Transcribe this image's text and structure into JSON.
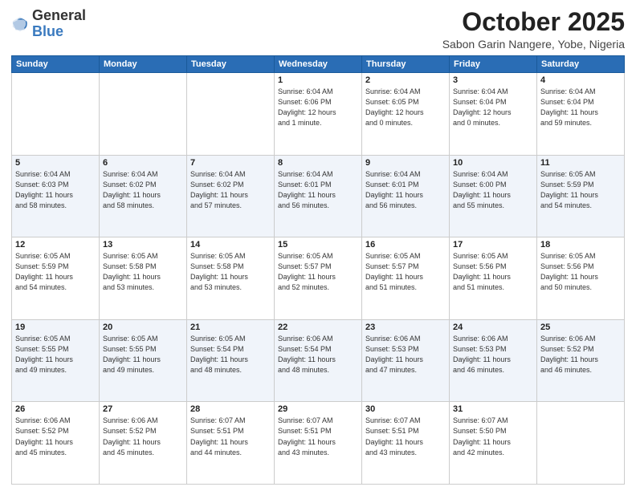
{
  "header": {
    "logo_general": "General",
    "logo_blue": "Blue",
    "month": "October 2025",
    "location": "Sabon Garin Nangere, Yobe, Nigeria"
  },
  "weekdays": [
    "Sunday",
    "Monday",
    "Tuesday",
    "Wednesday",
    "Thursday",
    "Friday",
    "Saturday"
  ],
  "weeks": [
    [
      {
        "day": null,
        "info": null
      },
      {
        "day": null,
        "info": null
      },
      {
        "day": null,
        "info": null
      },
      {
        "day": "1",
        "info": "Sunrise: 6:04 AM\nSunset: 6:06 PM\nDaylight: 12 hours\nand 1 minute."
      },
      {
        "day": "2",
        "info": "Sunrise: 6:04 AM\nSunset: 6:05 PM\nDaylight: 12 hours\nand 0 minutes."
      },
      {
        "day": "3",
        "info": "Sunrise: 6:04 AM\nSunset: 6:04 PM\nDaylight: 12 hours\nand 0 minutes."
      },
      {
        "day": "4",
        "info": "Sunrise: 6:04 AM\nSunset: 6:04 PM\nDaylight: 11 hours\nand 59 minutes."
      }
    ],
    [
      {
        "day": "5",
        "info": "Sunrise: 6:04 AM\nSunset: 6:03 PM\nDaylight: 11 hours\nand 58 minutes."
      },
      {
        "day": "6",
        "info": "Sunrise: 6:04 AM\nSunset: 6:02 PM\nDaylight: 11 hours\nand 58 minutes."
      },
      {
        "day": "7",
        "info": "Sunrise: 6:04 AM\nSunset: 6:02 PM\nDaylight: 11 hours\nand 57 minutes."
      },
      {
        "day": "8",
        "info": "Sunrise: 6:04 AM\nSunset: 6:01 PM\nDaylight: 11 hours\nand 56 minutes."
      },
      {
        "day": "9",
        "info": "Sunrise: 6:04 AM\nSunset: 6:01 PM\nDaylight: 11 hours\nand 56 minutes."
      },
      {
        "day": "10",
        "info": "Sunrise: 6:04 AM\nSunset: 6:00 PM\nDaylight: 11 hours\nand 55 minutes."
      },
      {
        "day": "11",
        "info": "Sunrise: 6:05 AM\nSunset: 5:59 PM\nDaylight: 11 hours\nand 54 minutes."
      }
    ],
    [
      {
        "day": "12",
        "info": "Sunrise: 6:05 AM\nSunset: 5:59 PM\nDaylight: 11 hours\nand 54 minutes."
      },
      {
        "day": "13",
        "info": "Sunrise: 6:05 AM\nSunset: 5:58 PM\nDaylight: 11 hours\nand 53 minutes."
      },
      {
        "day": "14",
        "info": "Sunrise: 6:05 AM\nSunset: 5:58 PM\nDaylight: 11 hours\nand 53 minutes."
      },
      {
        "day": "15",
        "info": "Sunrise: 6:05 AM\nSunset: 5:57 PM\nDaylight: 11 hours\nand 52 minutes."
      },
      {
        "day": "16",
        "info": "Sunrise: 6:05 AM\nSunset: 5:57 PM\nDaylight: 11 hours\nand 51 minutes."
      },
      {
        "day": "17",
        "info": "Sunrise: 6:05 AM\nSunset: 5:56 PM\nDaylight: 11 hours\nand 51 minutes."
      },
      {
        "day": "18",
        "info": "Sunrise: 6:05 AM\nSunset: 5:56 PM\nDaylight: 11 hours\nand 50 minutes."
      }
    ],
    [
      {
        "day": "19",
        "info": "Sunrise: 6:05 AM\nSunset: 5:55 PM\nDaylight: 11 hours\nand 49 minutes."
      },
      {
        "day": "20",
        "info": "Sunrise: 6:05 AM\nSunset: 5:55 PM\nDaylight: 11 hours\nand 49 minutes."
      },
      {
        "day": "21",
        "info": "Sunrise: 6:05 AM\nSunset: 5:54 PM\nDaylight: 11 hours\nand 48 minutes."
      },
      {
        "day": "22",
        "info": "Sunrise: 6:06 AM\nSunset: 5:54 PM\nDaylight: 11 hours\nand 48 minutes."
      },
      {
        "day": "23",
        "info": "Sunrise: 6:06 AM\nSunset: 5:53 PM\nDaylight: 11 hours\nand 47 minutes."
      },
      {
        "day": "24",
        "info": "Sunrise: 6:06 AM\nSunset: 5:53 PM\nDaylight: 11 hours\nand 46 minutes."
      },
      {
        "day": "25",
        "info": "Sunrise: 6:06 AM\nSunset: 5:52 PM\nDaylight: 11 hours\nand 46 minutes."
      }
    ],
    [
      {
        "day": "26",
        "info": "Sunrise: 6:06 AM\nSunset: 5:52 PM\nDaylight: 11 hours\nand 45 minutes."
      },
      {
        "day": "27",
        "info": "Sunrise: 6:06 AM\nSunset: 5:52 PM\nDaylight: 11 hours\nand 45 minutes."
      },
      {
        "day": "28",
        "info": "Sunrise: 6:07 AM\nSunset: 5:51 PM\nDaylight: 11 hours\nand 44 minutes."
      },
      {
        "day": "29",
        "info": "Sunrise: 6:07 AM\nSunset: 5:51 PM\nDaylight: 11 hours\nand 43 minutes."
      },
      {
        "day": "30",
        "info": "Sunrise: 6:07 AM\nSunset: 5:51 PM\nDaylight: 11 hours\nand 43 minutes."
      },
      {
        "day": "31",
        "info": "Sunrise: 6:07 AM\nSunset: 5:50 PM\nDaylight: 11 hours\nand 42 minutes."
      },
      {
        "day": null,
        "info": null
      }
    ]
  ]
}
